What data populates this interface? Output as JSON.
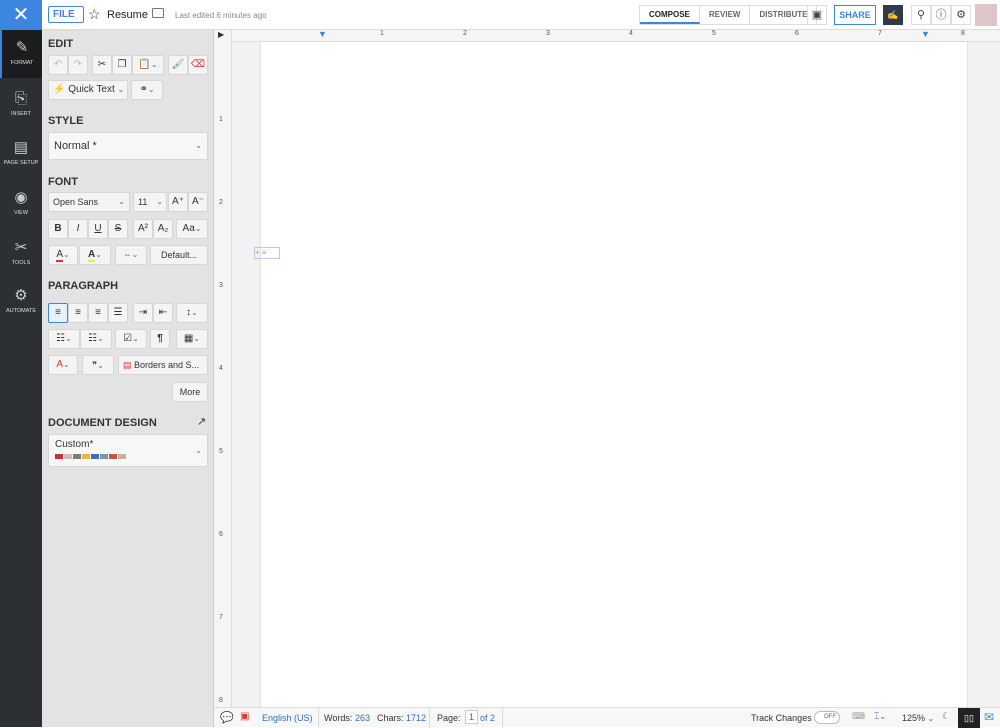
{
  "header": {
    "close": "✕",
    "file_label": "FILE",
    "doc_title": "Resume",
    "last_edited": "Last edited 6 minutes ago",
    "tabs": [
      {
        "label": "COMPOSE",
        "active": true
      },
      {
        "label": "REVIEW"
      },
      {
        "label": "DISTRIBUTE"
      }
    ],
    "share_label": "SHARE"
  },
  "nav": [
    {
      "label": "FORMAT",
      "active": true
    },
    {
      "label": "INSERT"
    },
    {
      "label": "PAGE SETUP"
    },
    {
      "label": "VIEW"
    },
    {
      "label": "TOOLS"
    },
    {
      "label": "AUTOMATE"
    }
  ],
  "panel": {
    "edit": {
      "title": "EDIT",
      "quick_text": "Quick Text"
    },
    "style": {
      "title": "STYLE",
      "value": "Normal *"
    },
    "font": {
      "title": "FONT",
      "family": "Open Sans",
      "size": "11",
      "default_label": "Default..."
    },
    "paragraph": {
      "title": "PARAGRAPH",
      "borders_label": "Borders and S...",
      "more_label": "More"
    },
    "design": {
      "title": "DOCUMENT DESIGN",
      "value": "Custom*",
      "swatches": [
        "#c8342c",
        "#c9c2b4",
        "#7a7a7a",
        "#e6b93a",
        "#3e6fb5",
        "#7c93b5",
        "#d0522e",
        "#c0b49a"
      ]
    }
  },
  "ruler": {
    "h": [
      "1",
      "2",
      "3",
      "4",
      "5",
      "6",
      "7",
      "8"
    ],
    "v": [
      "1",
      "2",
      "3",
      "4",
      "5",
      "6",
      "7",
      "8"
    ]
  },
  "status": {
    "language": "English (US)",
    "words_label": "Words:",
    "words": "263",
    "chars_label": "Chars:",
    "chars": "1712",
    "page_label": "Page:",
    "page": "1",
    "page_of": "of 2",
    "track_changes": "Track Changes",
    "toggle": "OFF",
    "zoom": "125%"
  },
  "colors": {
    "accent": "#3c86e0",
    "nav_bg": "#2c3034"
  }
}
